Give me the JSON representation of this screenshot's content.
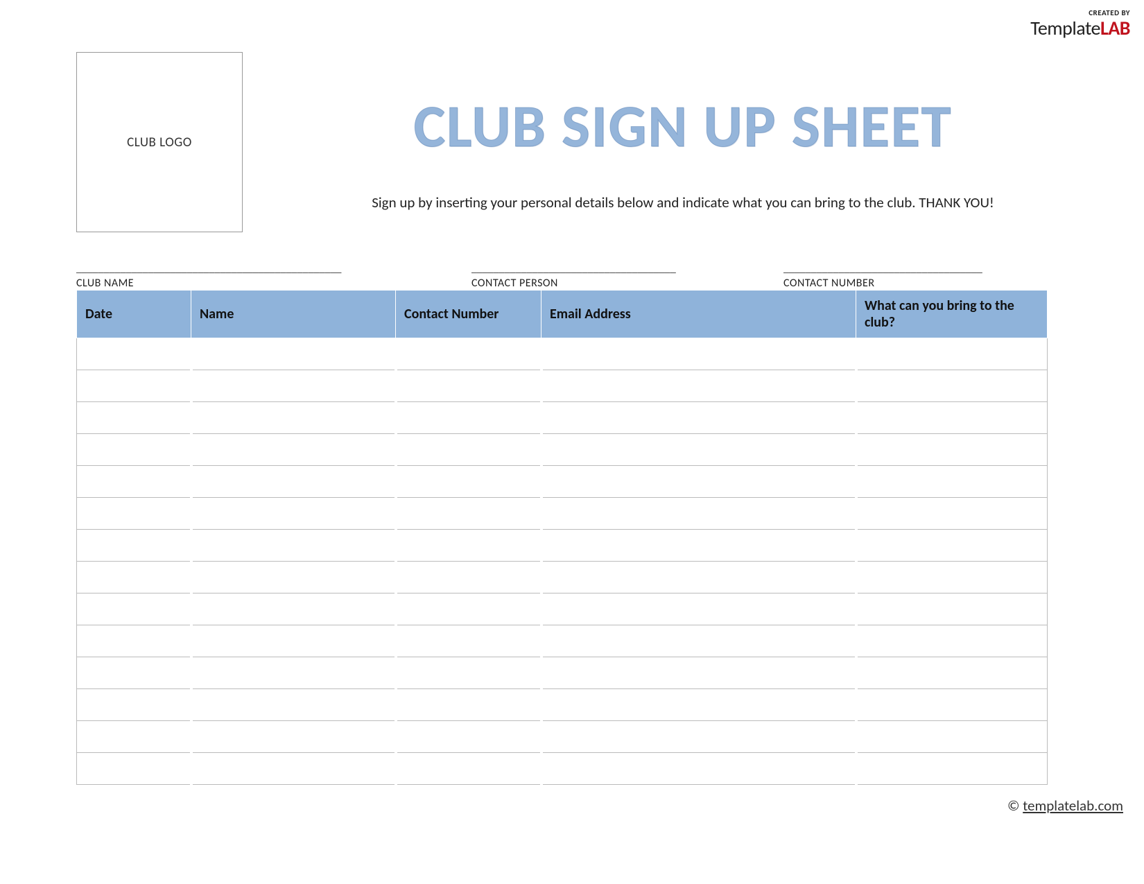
{
  "brand": {
    "created_by": "CREATED BY",
    "name_part1": "Template",
    "name_part2": "LAB"
  },
  "logo_placeholder": "CLUB LOGO",
  "title": "CLUB SIGN UP SHEET",
  "subtitle": "Sign up by inserting your personal details below and indicate what you can bring to the club. THANK YOU!",
  "fields": {
    "club_name": {
      "line": "________________________________________________",
      "label": "CLUB NAME"
    },
    "contact_person": {
      "line": "_____________________________________",
      "label": "CONTACT PERSON"
    },
    "contact_number": {
      "line": "____________________________________",
      "label": "CONTACT NUMBER"
    }
  },
  "table": {
    "headers": [
      "Date",
      "Name",
      "Contact Number",
      "Email Address",
      "What can you bring to the club?"
    ],
    "row_count": 14
  },
  "footer": {
    "copyright": "©",
    "link_text": "templatelab.com"
  }
}
